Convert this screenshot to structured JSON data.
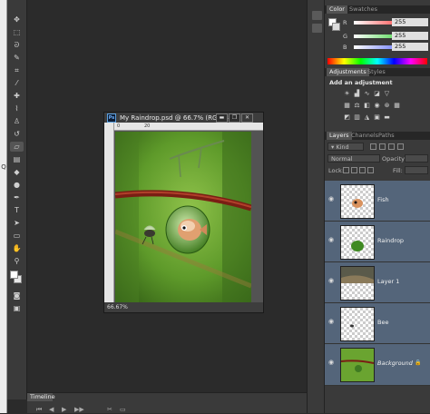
{
  "left_strip": {
    "glyphs": [
      "Q"
    ]
  },
  "tools": [
    "move-tool",
    "marquee-tool",
    "lasso-tool",
    "quick-select-tool",
    "crop-tool",
    "eyedropper-tool",
    "healing-tool",
    "brush-tool",
    "clone-stamp-tool",
    "history-brush-tool",
    "eraser-tool",
    "gradient-tool",
    "blur-tool",
    "dodge-tool",
    "pen-tool",
    "type-tool",
    "path-select-tool",
    "shape-tool",
    "hand-tool",
    "zoom-tool"
  ],
  "colors": {
    "foreground": "#ffffff",
    "background": "#e8e8e8"
  },
  "document": {
    "title": "My Raindrop.psd @ 66.7% (RGB/8#)",
    "ps_badge": "Ps",
    "ruler_ticks": [
      "0",
      "20"
    ],
    "zoom": "66.67%",
    "minimize": "▬",
    "restore": "❐",
    "close": "✕"
  },
  "color_panel": {
    "tabs": [
      "Color",
      "Swatches"
    ],
    "channels": [
      {
        "label": "R",
        "value": "255",
        "color": "#ff3b3b"
      },
      {
        "label": "G",
        "value": "255",
        "color": "#3bd13b"
      },
      {
        "label": "B",
        "value": "255",
        "color": "#5b6bff"
      }
    ]
  },
  "adjustments_panel": {
    "tabs": [
      "Adjustments",
      "Styles"
    ],
    "heading": "Add an adjustment"
  },
  "layers_panel": {
    "tabs": [
      "Layers",
      "Channels",
      "Paths"
    ],
    "filter_kind": "Kind",
    "blend_mode": "Normal",
    "opacity_label": "Opacity:",
    "lock_label": "Lock:",
    "fill_label": "Fill:",
    "layers": [
      {
        "name": "Fish",
        "selected": true
      },
      {
        "name": "Raindrop",
        "selected": true
      },
      {
        "name": "Layer 1",
        "selected": true
      },
      {
        "name": "Bee",
        "selected": true
      },
      {
        "name": "Background",
        "selected": true,
        "locked": true
      }
    ]
  },
  "timeline": {
    "tab": "Timeline"
  }
}
